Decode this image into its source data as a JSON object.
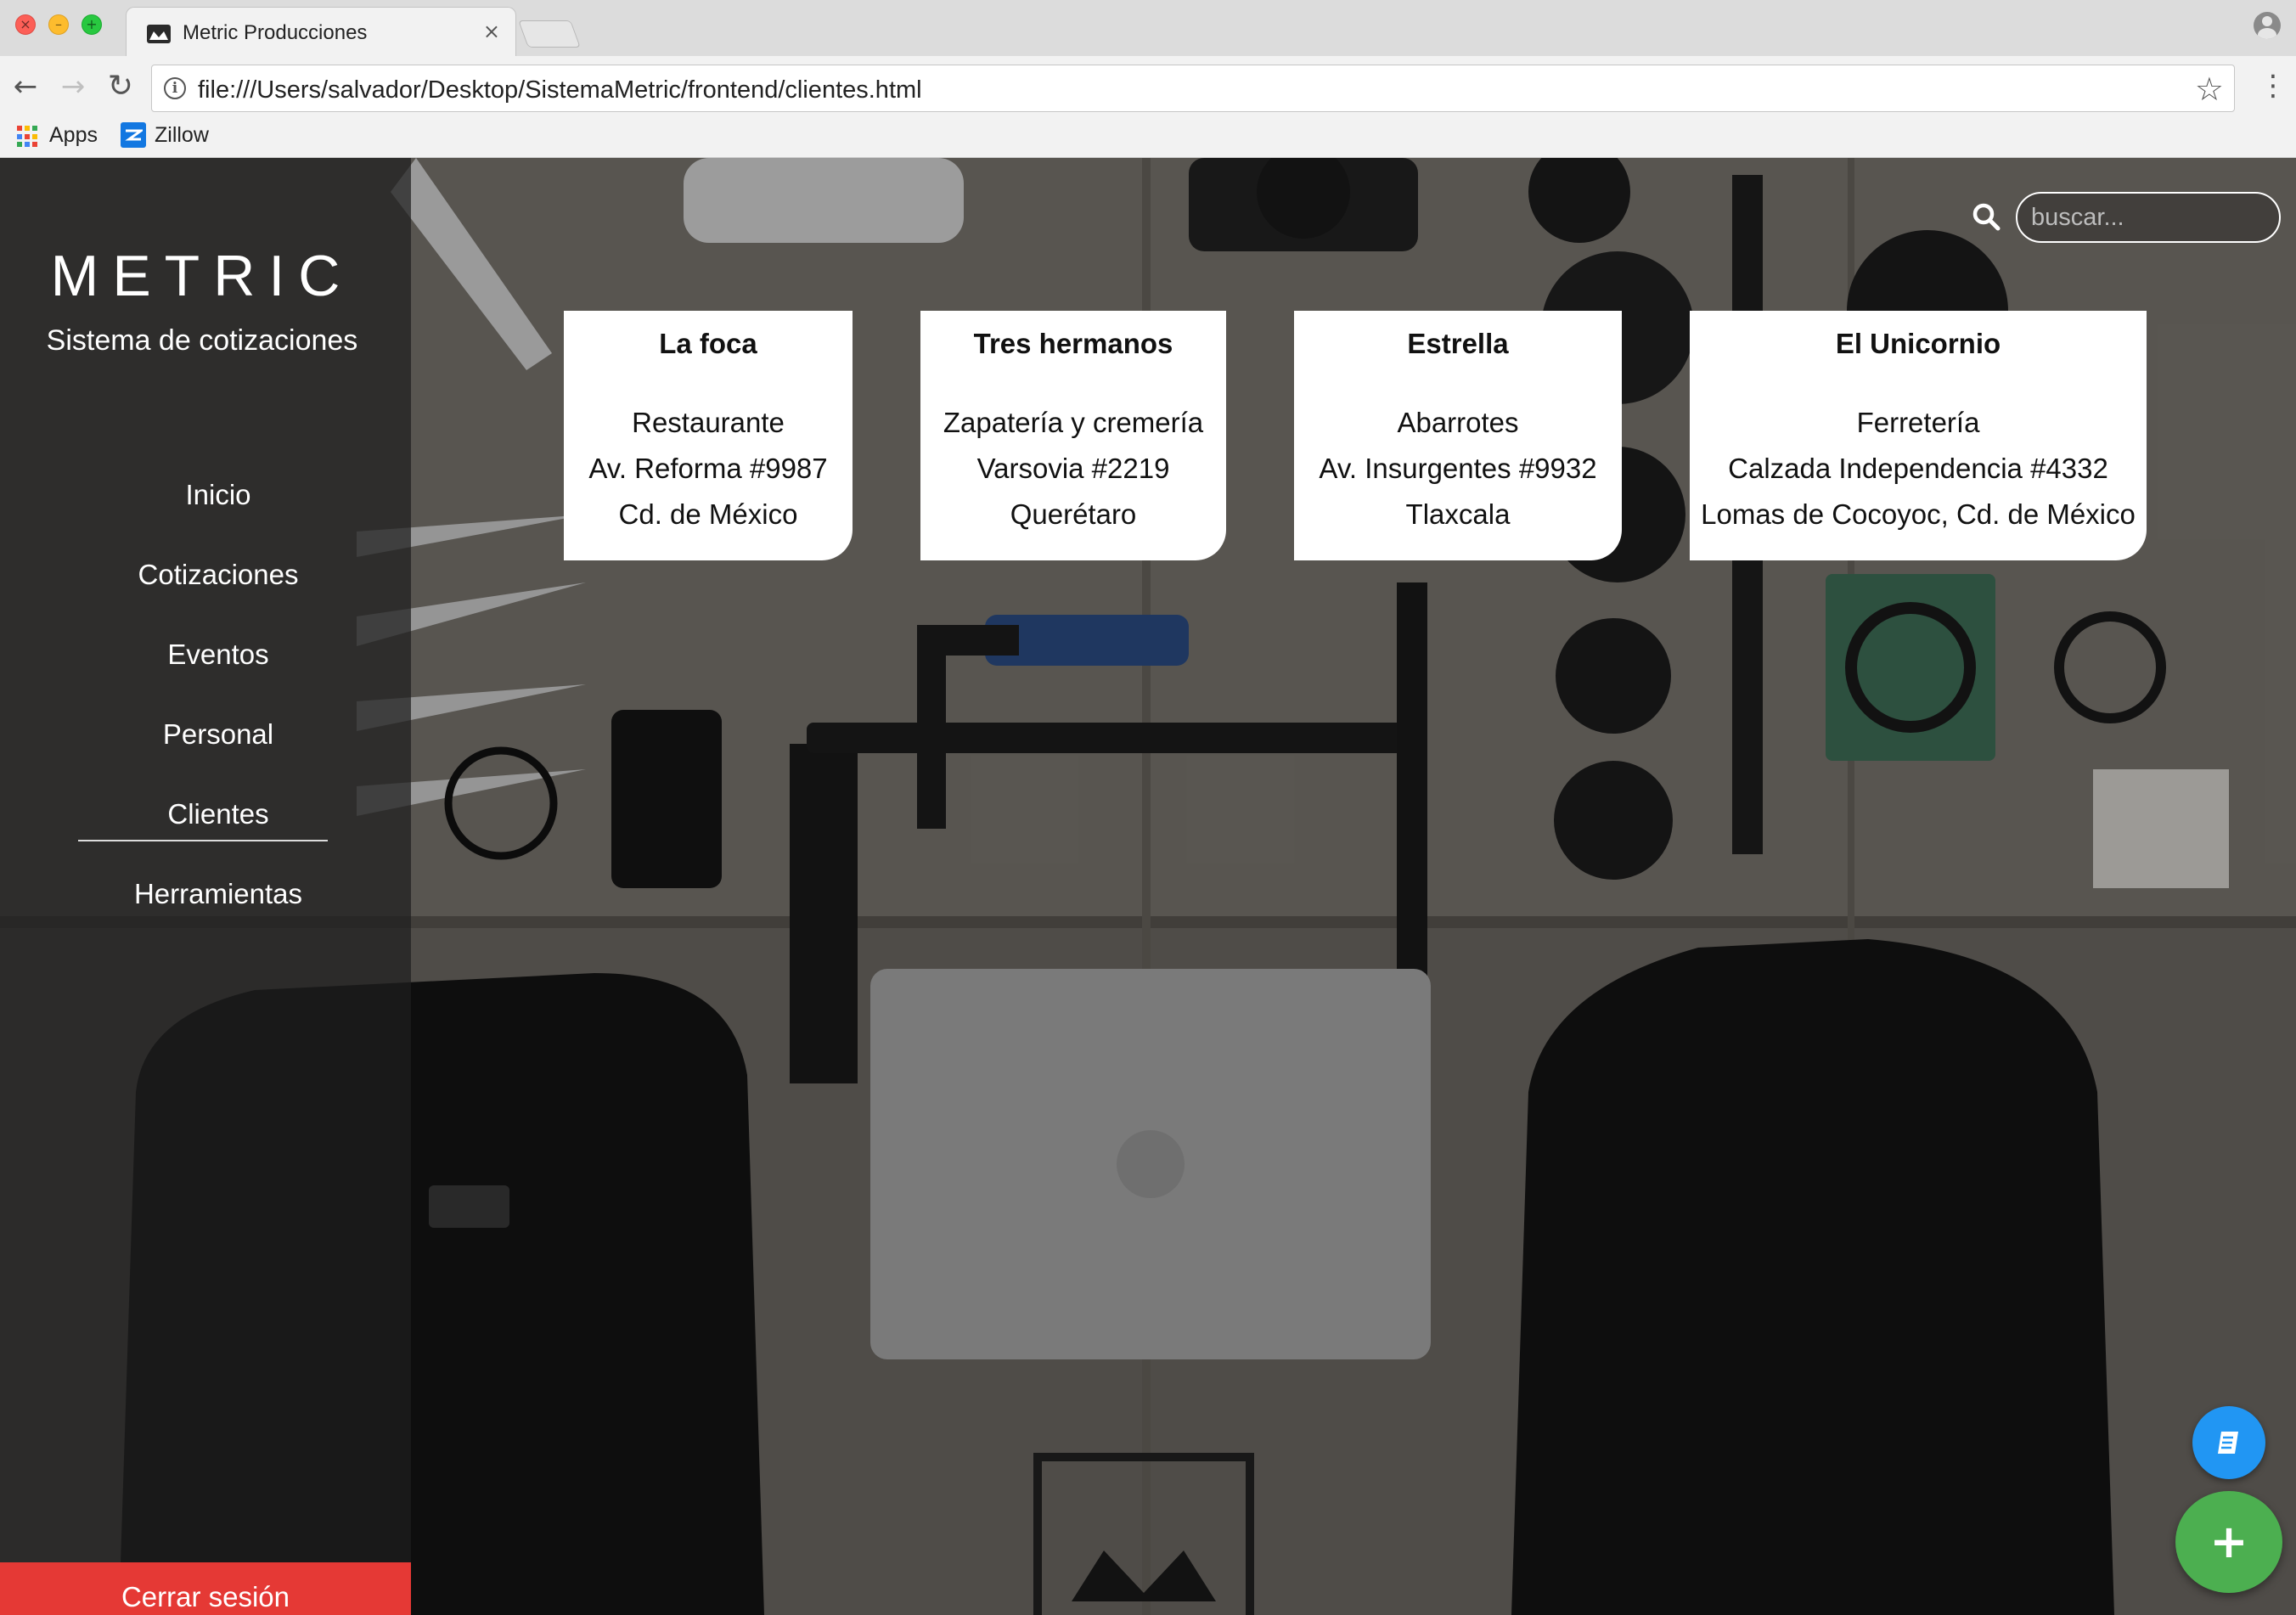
{
  "browser": {
    "tab_title": "Metric Producciones",
    "tab_close": "×",
    "url": "file:///Users/salvador/Desktop/SistemaMetric/frontend/clientes.html",
    "bookmarks": [
      {
        "label": "Apps",
        "icon": "apps-grid-icon"
      },
      {
        "label": "Zillow",
        "icon": "zillow-icon"
      }
    ]
  },
  "sidebar": {
    "brand": "METRIC",
    "subtitle": "Sistema de cotizaciones",
    "menu": [
      {
        "label": "Inicio"
      },
      {
        "label": "Cotizaciones"
      },
      {
        "label": "Eventos"
      },
      {
        "label": "Personal"
      },
      {
        "label": "Clientes",
        "active": true
      },
      {
        "label": "Herramientas"
      }
    ],
    "logout_label": "Cerrar sesión"
  },
  "search": {
    "placeholder": "buscar..."
  },
  "clients": [
    {
      "name": "La foca",
      "type": "Restaurante",
      "address": "Av. Reforma #9987",
      "city": "Cd. de México"
    },
    {
      "name": "Tres hermanos",
      "type": "Zapatería y cremería",
      "address": "Varsovia #2219",
      "city": "Querétaro"
    },
    {
      "name": "Estrella",
      "type": "Abarrotes",
      "address": "Av. Insurgentes #9932",
      "city": "Tlaxcala"
    },
    {
      "name": "El Unicornio",
      "type": "Ferretería",
      "address": "Calzada Independencia #4332",
      "city": "Lomas de Cocoyoc, Cd. de México"
    }
  ],
  "fab": {
    "add_label": "+",
    "book_icon": "book-icon"
  },
  "colors": {
    "logout_red": "#e53935",
    "fab_blue": "#2196f3",
    "fab_green": "#4caf50"
  }
}
